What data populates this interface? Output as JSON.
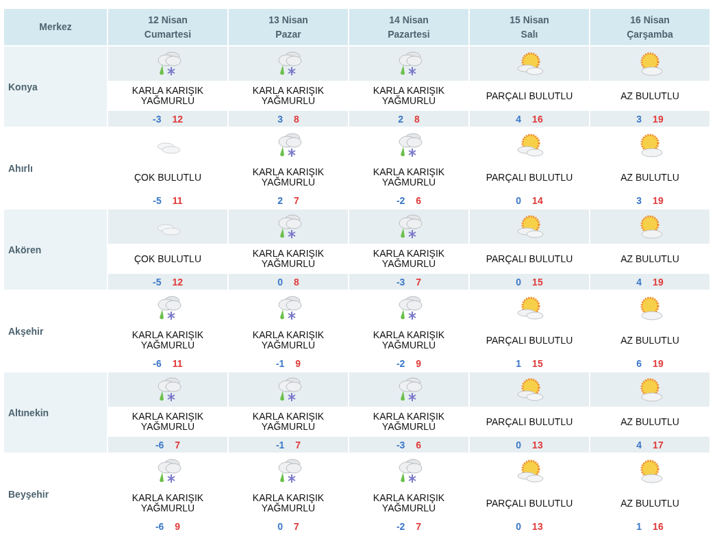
{
  "table": {
    "corner_header": "Merkez",
    "columns": [
      {
        "date": "12 Nisan",
        "day": "Cumartesi"
      },
      {
        "date": "13 Nisan",
        "day": "Pazar"
      },
      {
        "date": "14 Nisan",
        "day": "Pazartesi"
      },
      {
        "date": "15 Nisan",
        "day": "Salı"
      },
      {
        "date": "16 Nisan",
        "day": "Çarşamba"
      }
    ],
    "rows": [
      {
        "city": "Konya",
        "shaded": true,
        "days": [
          {
            "kind": "sleet",
            "condition": "KARLA KARIŞIK YAĞMURLU",
            "low": "-3",
            "high": "12"
          },
          {
            "kind": "sleet",
            "condition": "KARLA KARIŞIK YAĞMURLU",
            "low": "3",
            "high": "8"
          },
          {
            "kind": "sleet",
            "condition": "KARLA KARIŞIK YAĞMURLU",
            "low": "2",
            "high": "8"
          },
          {
            "kind": "partly",
            "condition": "PARÇALI BULUTLU",
            "low": "4",
            "high": "16"
          },
          {
            "kind": "sunny",
            "condition": "AZ BULUTLU",
            "low": "3",
            "high": "19"
          }
        ]
      },
      {
        "city": "Ahırlı",
        "shaded": false,
        "days": [
          {
            "kind": "cloudy",
            "condition": "ÇOK BULUTLU",
            "low": "-5",
            "high": "11"
          },
          {
            "kind": "sleet",
            "condition": "KARLA KARIŞIK YAĞMURLU",
            "low": "2",
            "high": "7"
          },
          {
            "kind": "sleet",
            "condition": "KARLA KARIŞIK YAĞMURLU",
            "low": "-2",
            "high": "6"
          },
          {
            "kind": "partly",
            "condition": "PARÇALI BULUTLU",
            "low": "0",
            "high": "14"
          },
          {
            "kind": "sunny",
            "condition": "AZ BULUTLU",
            "low": "3",
            "high": "19"
          }
        ]
      },
      {
        "city": "Akören",
        "shaded": true,
        "days": [
          {
            "kind": "cloudy",
            "condition": "ÇOK BULUTLU",
            "low": "-5",
            "high": "12"
          },
          {
            "kind": "sleet",
            "condition": "KARLA KARIŞIK YAĞMURLU",
            "low": "0",
            "high": "8"
          },
          {
            "kind": "sleet",
            "condition": "KARLA KARIŞIK YAĞMURLU",
            "low": "-3",
            "high": "7"
          },
          {
            "kind": "partly",
            "condition": "PARÇALI BULUTLU",
            "low": "0",
            "high": "15"
          },
          {
            "kind": "sunny",
            "condition": "AZ BULUTLU",
            "low": "4",
            "high": "19"
          }
        ]
      },
      {
        "city": "Akşehir",
        "shaded": false,
        "days": [
          {
            "kind": "sleet",
            "condition": "KARLA KARIŞIK YAĞMURLU",
            "low": "-6",
            "high": "11"
          },
          {
            "kind": "sleet",
            "condition": "KARLA KARIŞIK YAĞMURLU",
            "low": "-1",
            "high": "9"
          },
          {
            "kind": "sleet",
            "condition": "KARLA KARIŞIK YAĞMURLU",
            "low": "-2",
            "high": "9"
          },
          {
            "kind": "partly",
            "condition": "PARÇALI BULUTLU",
            "low": "1",
            "high": "15"
          },
          {
            "kind": "sunny",
            "condition": "AZ BULUTLU",
            "low": "6",
            "high": "19"
          }
        ]
      },
      {
        "city": "Altınekin",
        "shaded": true,
        "days": [
          {
            "kind": "sleet",
            "condition": "KARLA KARIŞIK YAĞMURLU",
            "low": "-6",
            "high": "7"
          },
          {
            "kind": "sleet",
            "condition": "KARLA KARIŞIK YAĞMURLU",
            "low": "-1",
            "high": "7"
          },
          {
            "kind": "sleet",
            "condition": "KARLA KARIŞIK YAĞMURLU",
            "low": "-3",
            "high": "6"
          },
          {
            "kind": "partly",
            "condition": "PARÇALI BULUTLU",
            "low": "0",
            "high": "13"
          },
          {
            "kind": "sunny",
            "condition": "AZ BULUTLU",
            "low": "4",
            "high": "17"
          }
        ]
      },
      {
        "city": "Beyşehir",
        "shaded": false,
        "days": [
          {
            "kind": "sleet",
            "condition": "KARLA KARIŞIK YAĞMURLU",
            "low": "-6",
            "high": "9"
          },
          {
            "kind": "sleet",
            "condition": "KARLA KARIŞIK YAĞMURLU",
            "low": "0",
            "high": "7"
          },
          {
            "kind": "sleet",
            "condition": "KARLA KARIŞIK YAĞMURLU",
            "low": "-2",
            "high": "7"
          },
          {
            "kind": "partly",
            "condition": "PARÇALI BULUTLU",
            "low": "0",
            "high": "13"
          },
          {
            "kind": "sunny",
            "condition": "AZ BULUTLU",
            "low": "1",
            "high": "16"
          }
        ]
      }
    ]
  }
}
